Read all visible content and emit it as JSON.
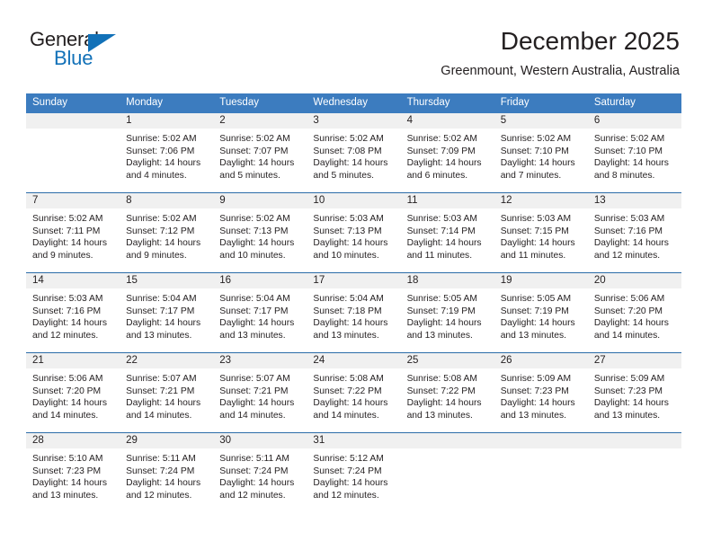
{
  "logo": {
    "word_one": "General",
    "word_two": "Blue",
    "triangle_color": "#1271b8"
  },
  "header": {
    "title": "December 2025",
    "location": "Greenmount, Western Australia, Australia"
  },
  "theme": {
    "header_blue": "#3c7cbf",
    "row_divider_blue": "#2b6ca8",
    "daynum_band": "#f0f0f0",
    "text": "#231f20"
  },
  "weekdays": [
    "Sunday",
    "Monday",
    "Tuesday",
    "Wednesday",
    "Thursday",
    "Friday",
    "Saturday"
  ],
  "labels": {
    "sunrise_prefix": "Sunrise:",
    "sunset_prefix": "Sunset:",
    "daylight_prefix": "Daylight:"
  },
  "weeks": [
    [
      {
        "day": "",
        "sunrise": "",
        "sunset": "",
        "daylight_line1": "",
        "daylight_line2": ""
      },
      {
        "day": "1",
        "sunrise": "Sunrise: 5:02 AM",
        "sunset": "Sunset: 7:06 PM",
        "daylight_line1": "Daylight: 14 hours",
        "daylight_line2": "and 4 minutes."
      },
      {
        "day": "2",
        "sunrise": "Sunrise: 5:02 AM",
        "sunset": "Sunset: 7:07 PM",
        "daylight_line1": "Daylight: 14 hours",
        "daylight_line2": "and 5 minutes."
      },
      {
        "day": "3",
        "sunrise": "Sunrise: 5:02 AM",
        "sunset": "Sunset: 7:08 PM",
        "daylight_line1": "Daylight: 14 hours",
        "daylight_line2": "and 5 minutes."
      },
      {
        "day": "4",
        "sunrise": "Sunrise: 5:02 AM",
        "sunset": "Sunset: 7:09 PM",
        "daylight_line1": "Daylight: 14 hours",
        "daylight_line2": "and 6 minutes."
      },
      {
        "day": "5",
        "sunrise": "Sunrise: 5:02 AM",
        "sunset": "Sunset: 7:10 PM",
        "daylight_line1": "Daylight: 14 hours",
        "daylight_line2": "and 7 minutes."
      },
      {
        "day": "6",
        "sunrise": "Sunrise: 5:02 AM",
        "sunset": "Sunset: 7:10 PM",
        "daylight_line1": "Daylight: 14 hours",
        "daylight_line2": "and 8 minutes."
      }
    ],
    [
      {
        "day": "7",
        "sunrise": "Sunrise: 5:02 AM",
        "sunset": "Sunset: 7:11 PM",
        "daylight_line1": "Daylight: 14 hours",
        "daylight_line2": "and 9 minutes."
      },
      {
        "day": "8",
        "sunrise": "Sunrise: 5:02 AM",
        "sunset": "Sunset: 7:12 PM",
        "daylight_line1": "Daylight: 14 hours",
        "daylight_line2": "and 9 minutes."
      },
      {
        "day": "9",
        "sunrise": "Sunrise: 5:02 AM",
        "sunset": "Sunset: 7:13 PM",
        "daylight_line1": "Daylight: 14 hours",
        "daylight_line2": "and 10 minutes."
      },
      {
        "day": "10",
        "sunrise": "Sunrise: 5:03 AM",
        "sunset": "Sunset: 7:13 PM",
        "daylight_line1": "Daylight: 14 hours",
        "daylight_line2": "and 10 minutes."
      },
      {
        "day": "11",
        "sunrise": "Sunrise: 5:03 AM",
        "sunset": "Sunset: 7:14 PM",
        "daylight_line1": "Daylight: 14 hours",
        "daylight_line2": "and 11 minutes."
      },
      {
        "day": "12",
        "sunrise": "Sunrise: 5:03 AM",
        "sunset": "Sunset: 7:15 PM",
        "daylight_line1": "Daylight: 14 hours",
        "daylight_line2": "and 11 minutes."
      },
      {
        "day": "13",
        "sunrise": "Sunrise: 5:03 AM",
        "sunset": "Sunset: 7:16 PM",
        "daylight_line1": "Daylight: 14 hours",
        "daylight_line2": "and 12 minutes."
      }
    ],
    [
      {
        "day": "14",
        "sunrise": "Sunrise: 5:03 AM",
        "sunset": "Sunset: 7:16 PM",
        "daylight_line1": "Daylight: 14 hours",
        "daylight_line2": "and 12 minutes."
      },
      {
        "day": "15",
        "sunrise": "Sunrise: 5:04 AM",
        "sunset": "Sunset: 7:17 PM",
        "daylight_line1": "Daylight: 14 hours",
        "daylight_line2": "and 13 minutes."
      },
      {
        "day": "16",
        "sunrise": "Sunrise: 5:04 AM",
        "sunset": "Sunset: 7:17 PM",
        "daylight_line1": "Daylight: 14 hours",
        "daylight_line2": "and 13 minutes."
      },
      {
        "day": "17",
        "sunrise": "Sunrise: 5:04 AM",
        "sunset": "Sunset: 7:18 PM",
        "daylight_line1": "Daylight: 14 hours",
        "daylight_line2": "and 13 minutes."
      },
      {
        "day": "18",
        "sunrise": "Sunrise: 5:05 AM",
        "sunset": "Sunset: 7:19 PM",
        "daylight_line1": "Daylight: 14 hours",
        "daylight_line2": "and 13 minutes."
      },
      {
        "day": "19",
        "sunrise": "Sunrise: 5:05 AM",
        "sunset": "Sunset: 7:19 PM",
        "daylight_line1": "Daylight: 14 hours",
        "daylight_line2": "and 13 minutes."
      },
      {
        "day": "20",
        "sunrise": "Sunrise: 5:06 AM",
        "sunset": "Sunset: 7:20 PM",
        "daylight_line1": "Daylight: 14 hours",
        "daylight_line2": "and 14 minutes."
      }
    ],
    [
      {
        "day": "21",
        "sunrise": "Sunrise: 5:06 AM",
        "sunset": "Sunset: 7:20 PM",
        "daylight_line1": "Daylight: 14 hours",
        "daylight_line2": "and 14 minutes."
      },
      {
        "day": "22",
        "sunrise": "Sunrise: 5:07 AM",
        "sunset": "Sunset: 7:21 PM",
        "daylight_line1": "Daylight: 14 hours",
        "daylight_line2": "and 14 minutes."
      },
      {
        "day": "23",
        "sunrise": "Sunrise: 5:07 AM",
        "sunset": "Sunset: 7:21 PM",
        "daylight_line1": "Daylight: 14 hours",
        "daylight_line2": "and 14 minutes."
      },
      {
        "day": "24",
        "sunrise": "Sunrise: 5:08 AM",
        "sunset": "Sunset: 7:22 PM",
        "daylight_line1": "Daylight: 14 hours",
        "daylight_line2": "and 14 minutes."
      },
      {
        "day": "25",
        "sunrise": "Sunrise: 5:08 AM",
        "sunset": "Sunset: 7:22 PM",
        "daylight_line1": "Daylight: 14 hours",
        "daylight_line2": "and 13 minutes."
      },
      {
        "day": "26",
        "sunrise": "Sunrise: 5:09 AM",
        "sunset": "Sunset: 7:23 PM",
        "daylight_line1": "Daylight: 14 hours",
        "daylight_line2": "and 13 minutes."
      },
      {
        "day": "27",
        "sunrise": "Sunrise: 5:09 AM",
        "sunset": "Sunset: 7:23 PM",
        "daylight_line1": "Daylight: 14 hours",
        "daylight_line2": "and 13 minutes."
      }
    ],
    [
      {
        "day": "28",
        "sunrise": "Sunrise: 5:10 AM",
        "sunset": "Sunset: 7:23 PM",
        "daylight_line1": "Daylight: 14 hours",
        "daylight_line2": "and 13 minutes."
      },
      {
        "day": "29",
        "sunrise": "Sunrise: 5:11 AM",
        "sunset": "Sunset: 7:24 PM",
        "daylight_line1": "Daylight: 14 hours",
        "daylight_line2": "and 12 minutes."
      },
      {
        "day": "30",
        "sunrise": "Sunrise: 5:11 AM",
        "sunset": "Sunset: 7:24 PM",
        "daylight_line1": "Daylight: 14 hours",
        "daylight_line2": "and 12 minutes."
      },
      {
        "day": "31",
        "sunrise": "Sunrise: 5:12 AM",
        "sunset": "Sunset: 7:24 PM",
        "daylight_line1": "Daylight: 14 hours",
        "daylight_line2": "and 12 minutes."
      },
      {
        "day": "",
        "sunrise": "",
        "sunset": "",
        "daylight_line1": "",
        "daylight_line2": ""
      },
      {
        "day": "",
        "sunrise": "",
        "sunset": "",
        "daylight_line1": "",
        "daylight_line2": ""
      },
      {
        "day": "",
        "sunrise": "",
        "sunset": "",
        "daylight_line1": "",
        "daylight_line2": ""
      }
    ]
  ]
}
